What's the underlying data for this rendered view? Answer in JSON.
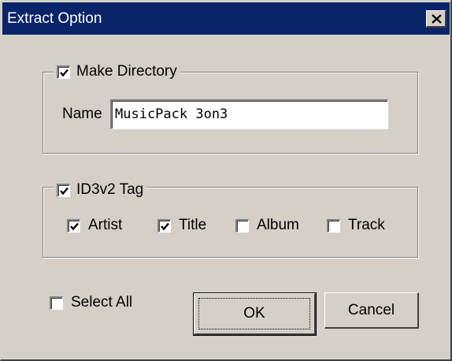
{
  "window": {
    "title": "Extract Option"
  },
  "make_directory": {
    "label": "Make Directory",
    "checked": true
  },
  "name_field": {
    "label": "Name",
    "value": "MusicPack 3on3"
  },
  "id3v2": {
    "label": "ID3v2 Tag",
    "checked": true,
    "options": [
      {
        "label": "Artist",
        "checked": true
      },
      {
        "label": "Title",
        "checked": true
      },
      {
        "label": "Album",
        "checked": false
      },
      {
        "label": "Track",
        "checked": false
      }
    ]
  },
  "select_all": {
    "label": "Select All",
    "checked": false
  },
  "buttons": {
    "ok": "OK",
    "cancel": "Cancel"
  },
  "icons": {
    "close": "close-icon",
    "check": "checkmark-icon"
  },
  "colors": {
    "titlebar": "#0a246a",
    "face": "#d4d0c8"
  }
}
